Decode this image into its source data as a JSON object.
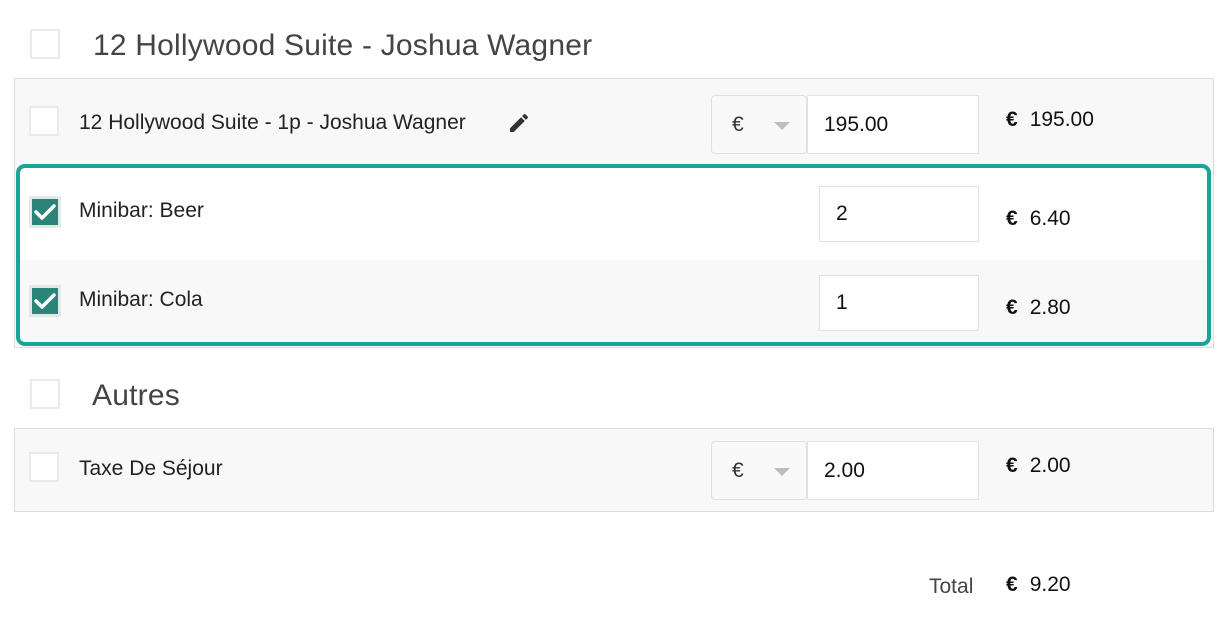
{
  "group1": {
    "title": "12 Hollywood Suite - Joshua Wagner",
    "row": {
      "label": "12 Hollywood Suite - 1p - Joshua Wagner",
      "currency_select": "€",
      "price_input": "195.00",
      "amount_currency": "€",
      "amount": "195.00"
    },
    "items": [
      {
        "label": "Minibar: Beer",
        "quantity": "2",
        "amount_currency": "€",
        "amount": "6.40",
        "checked": true
      },
      {
        "label": "Minibar: Cola",
        "quantity": "1",
        "amount_currency": "€",
        "amount": "2.80",
        "checked": true
      }
    ]
  },
  "group2": {
    "title": "Autres",
    "row": {
      "label": "Taxe De Séjour",
      "currency_select": "€",
      "price_input": "2.00",
      "amount_currency": "€",
      "amount": "2.00"
    }
  },
  "total": {
    "label": "Total",
    "currency": "€",
    "amount": "9.20"
  },
  "colors": {
    "highlight_border": "#16a596",
    "checkbox_checked": "#2a8477"
  },
  "icons": {
    "edit": "pencil-icon",
    "check": "checkmark-icon",
    "dropdown": "caret-down-icon"
  }
}
